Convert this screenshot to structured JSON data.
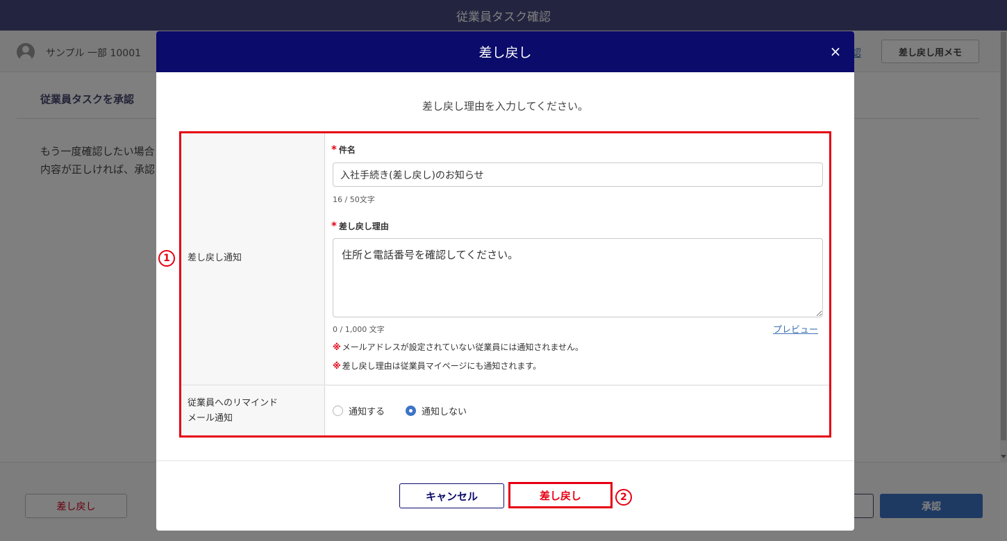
{
  "app": {
    "title": "従業員タスク確認"
  },
  "user": {
    "name": "サンプル 一部 10001"
  },
  "background": {
    "link_text": "認",
    "memo_button": "差し戻し用メモ",
    "section_title": "従業員タスクを承認",
    "body_line1": "もう一度確認したい場合",
    "body_line2": "内容が正しければ、承認",
    "footer_reject": "差し戻し",
    "footer_approve": "承認"
  },
  "modal": {
    "title": "差し戻し",
    "close_symbol": "×",
    "instruction": "差し戻し理由を入力してください。",
    "notify_label": "差し戻し通知",
    "subject": {
      "required_mark": "*",
      "label": "件名",
      "value": "入社手続き(差し戻し)のお知らせ",
      "counter": "16 / 50文字"
    },
    "reason": {
      "required_mark": "*",
      "label": "差し戻し理由",
      "value": "住所と電話番号を確認してください。",
      "counter": "0 / 1,000 文字",
      "preview_link": "プレビュー"
    },
    "notes": [
      {
        "mark": "※",
        "text": "メールアドレスが設定されていない従業員には通知されません。"
      },
      {
        "mark": "※",
        "text": "差し戻し理由は従業員マイページにも通知されます。"
      }
    ],
    "remind": {
      "label_line1": "従業員へのリマインド",
      "label_line2": "メール通知",
      "options": [
        {
          "label": "通知する",
          "selected": false
        },
        {
          "label": "通知しない",
          "selected": true
        }
      ]
    },
    "cancel_button": "キャンセル",
    "submit_button": "差し戻し"
  },
  "annotations": {
    "marker1": "1",
    "marker2": "2"
  },
  "colors": {
    "header": "#0b0b6b",
    "topbar": "#474a80",
    "highlight": "#e60012",
    "primary": "#3d74c7"
  }
}
